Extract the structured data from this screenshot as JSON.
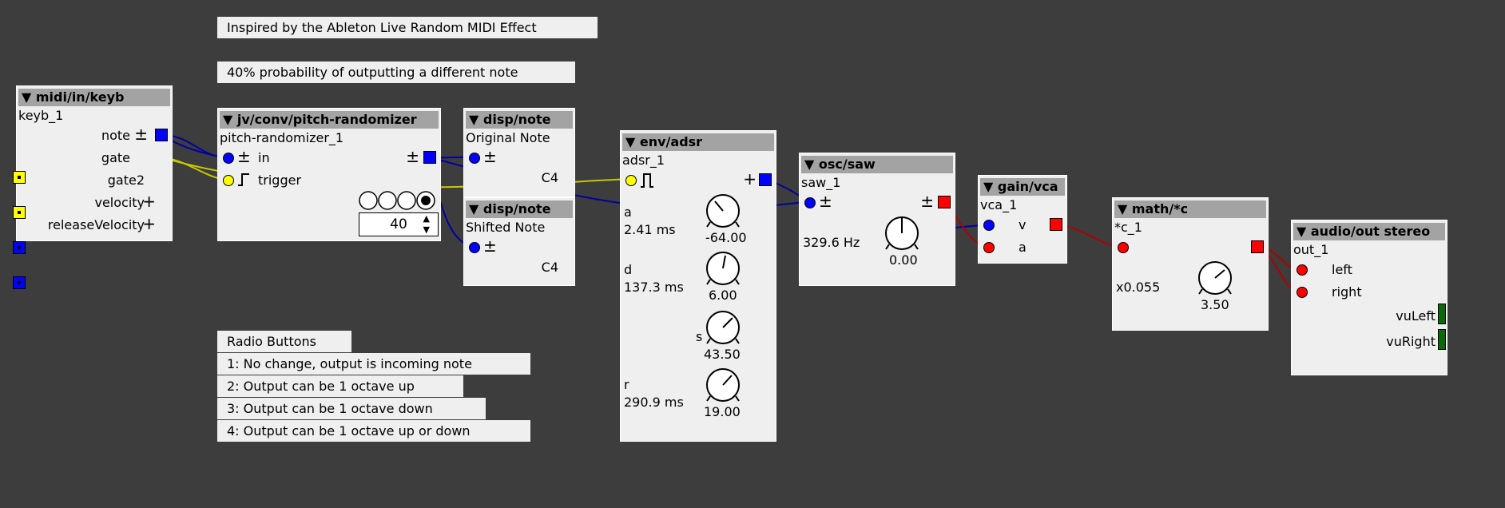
{
  "comments": {
    "inspired": "Inspired by the Ableton Live Random MIDI Effect",
    "probability": "40% probability of outputting a different note",
    "radio_title": "Radio Buttons",
    "radio_1": "1: No change, output is incoming note",
    "radio_2": "2: Output can be 1 octave up",
    "radio_3": "3: Output can be 1 octave down",
    "radio_4": "4: Output can be 1 octave up or down"
  },
  "keyb": {
    "type": "▼ midi/in/keyb",
    "instance": "keyb_1",
    "outlets": [
      "note",
      "gate",
      "gate2",
      "velocity",
      "releaseVelocity"
    ]
  },
  "randomizer": {
    "type": "▼ jv/conv/pitch-randomizer",
    "instance": "pitch-randomizer_1",
    "inlets": [
      "in",
      "trigger"
    ],
    "value": "40",
    "selected_radio": 4
  },
  "disp_orig": {
    "type": "▼ disp/note",
    "label": "Original Note",
    "value": "C4"
  },
  "disp_shift": {
    "type": "▼ disp/note",
    "label": "Shifted Note",
    "value": "C4"
  },
  "adsr": {
    "type": "▼ env/adsr",
    "instance": "adsr_1",
    "a_label": "a",
    "a_value": "2.41 ms",
    "a_knob": "-64.00",
    "d_label": "d",
    "d_value": "137.3 ms",
    "d_knob": "6.00",
    "s_label": "s",
    "s_knob": "43.50",
    "r_label": "r",
    "r_value": "290.9 ms",
    "r_knob": "19.00"
  },
  "saw": {
    "type": "▼ osc/saw",
    "instance": "saw_1",
    "freq": "329.6 Hz",
    "knob": "0.00"
  },
  "vca": {
    "type": "▼ gain/vca",
    "instance": "vca_1",
    "inlet_v": "v",
    "inlet_a": "a"
  },
  "mul": {
    "type": "▼ math/*c",
    "instance": "*c_1",
    "factor": "x0.055",
    "knob": "3.50"
  },
  "out": {
    "type": "▼ audio/out stereo",
    "instance": "out_1",
    "inlet_left": "left",
    "inlet_right": "right",
    "vu_left": "vuLeft",
    "vu_right": "vuRight"
  },
  "colors": {
    "background": "#3d3d3d",
    "panel": "#efefef",
    "header": "#a3a3a3",
    "frac32": "#0000ff",
    "bool": "#ffff00",
    "audio": "#ff0000"
  }
}
